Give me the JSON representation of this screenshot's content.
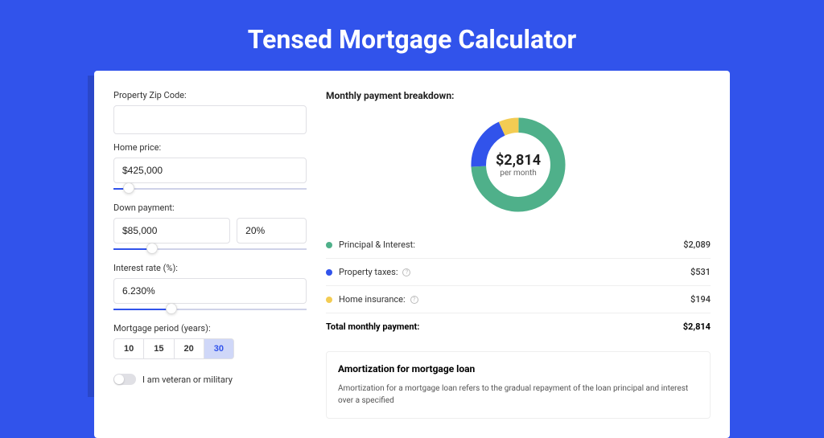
{
  "title": "Tensed Mortgage Calculator",
  "form": {
    "zip_label": "Property Zip Code:",
    "zip_value": "",
    "price_label": "Home price:",
    "price_value": "$425,000",
    "price_slider_pct": 8,
    "down_label": "Down payment:",
    "down_value": "$85,000",
    "down_pct": "20%",
    "down_slider_pct": 20,
    "rate_label": "Interest rate (%):",
    "rate_value": "6.230%",
    "rate_slider_pct": 30,
    "period_label": "Mortgage period (years):",
    "periods": [
      "10",
      "15",
      "20",
      "30"
    ],
    "period_active_index": 3,
    "veteran_label": "I am veteran or military",
    "veteran_on": false
  },
  "breakdown": {
    "title": "Monthly payment breakdown:",
    "donut_amount": "$2,814",
    "donut_sub": "per month",
    "items": [
      {
        "label": "Principal & Interest:",
        "value": "$2,089",
        "color": "#4fb08a",
        "info": false
      },
      {
        "label": "Property taxes:",
        "value": "$531",
        "color": "#3153eb",
        "info": true
      },
      {
        "label": "Home insurance:",
        "value": "$194",
        "color": "#f3cc53",
        "info": true
      }
    ],
    "total_label": "Total monthly payment:",
    "total_value": "$2,814"
  },
  "chart_data": {
    "type": "pie",
    "title": "Monthly payment breakdown",
    "series": [
      {
        "name": "Principal & Interest",
        "value": 2089,
        "color": "#4fb08a"
      },
      {
        "name": "Property taxes",
        "value": 531,
        "color": "#3153eb"
      },
      {
        "name": "Home insurance",
        "value": 194,
        "color": "#f3cc53"
      }
    ],
    "total": 2814,
    "center_label": "$2,814 per month"
  },
  "amortization": {
    "title": "Amortization for mortgage loan",
    "text": "Amortization for a mortgage loan refers to the gradual repayment of the loan principal and interest over a specified"
  }
}
